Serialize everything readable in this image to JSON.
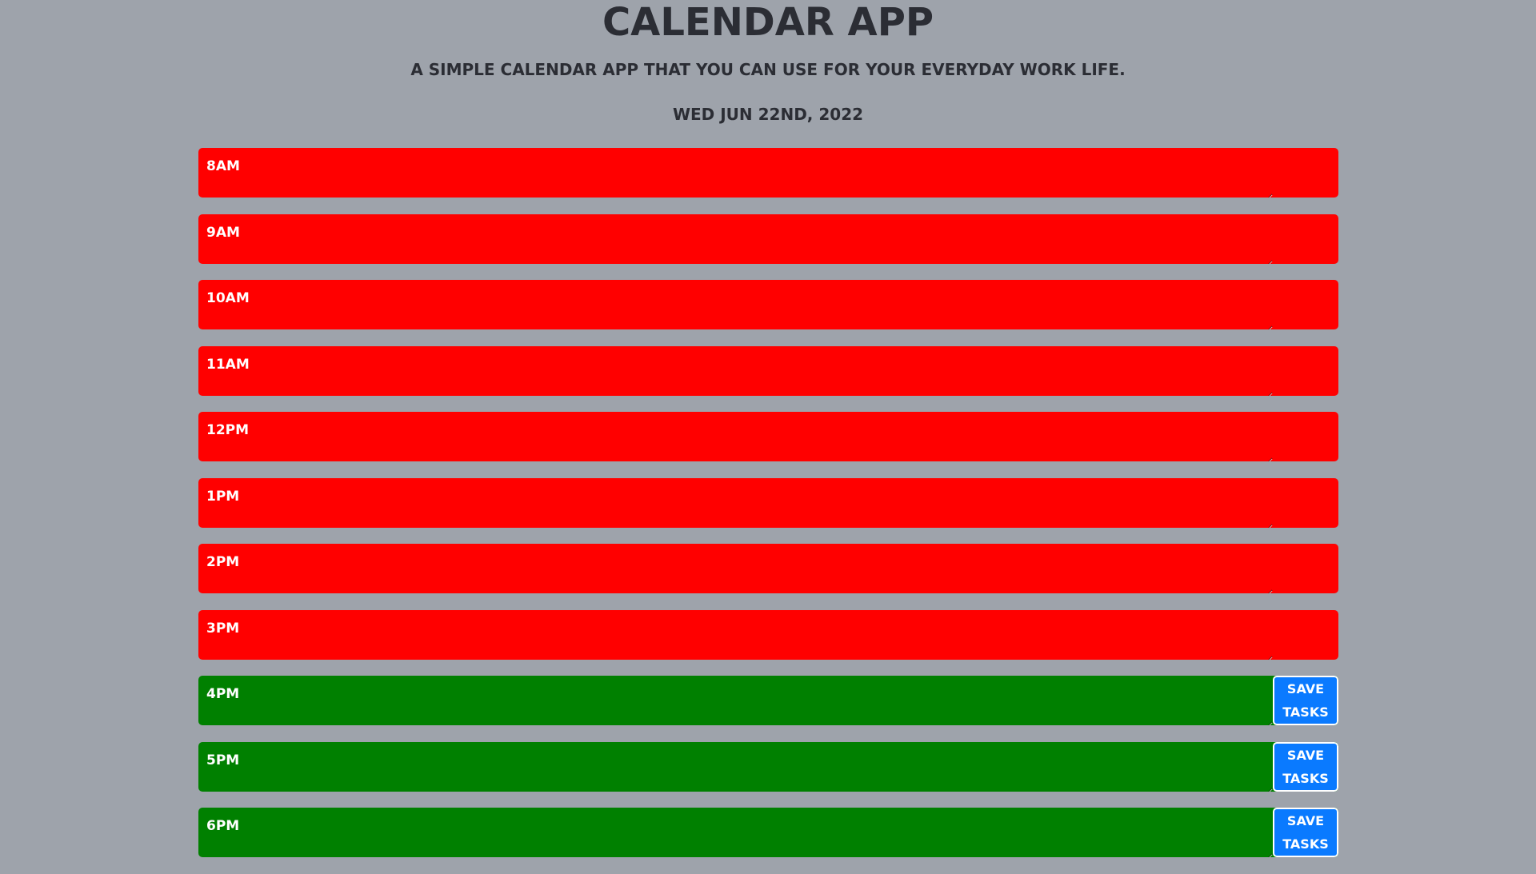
{
  "header": {
    "title": "Calendar App",
    "subtitle": "A simple calendar app that you can use for your everyday work life.",
    "date": "Wed Jun 22nd, 2022"
  },
  "colors": {
    "background": "#9ea3ab",
    "past": "#ff0000",
    "future": "#008000",
    "save_button": "#0a7aff"
  },
  "save_button": {
    "line1": "Save",
    "line2": "Tasks"
  },
  "rows": [
    {
      "hour": "8AM",
      "status": "past"
    },
    {
      "hour": "9AM",
      "status": "past"
    },
    {
      "hour": "10AM",
      "status": "past"
    },
    {
      "hour": "11AM",
      "status": "past"
    },
    {
      "hour": "12PM",
      "status": "past"
    },
    {
      "hour": "1PM",
      "status": "past"
    },
    {
      "hour": "2PM",
      "status": "past"
    },
    {
      "hour": "3PM",
      "status": "past"
    },
    {
      "hour": "4PM",
      "status": "future"
    },
    {
      "hour": "5PM",
      "status": "future"
    },
    {
      "hour": "6PM",
      "status": "future"
    }
  ]
}
